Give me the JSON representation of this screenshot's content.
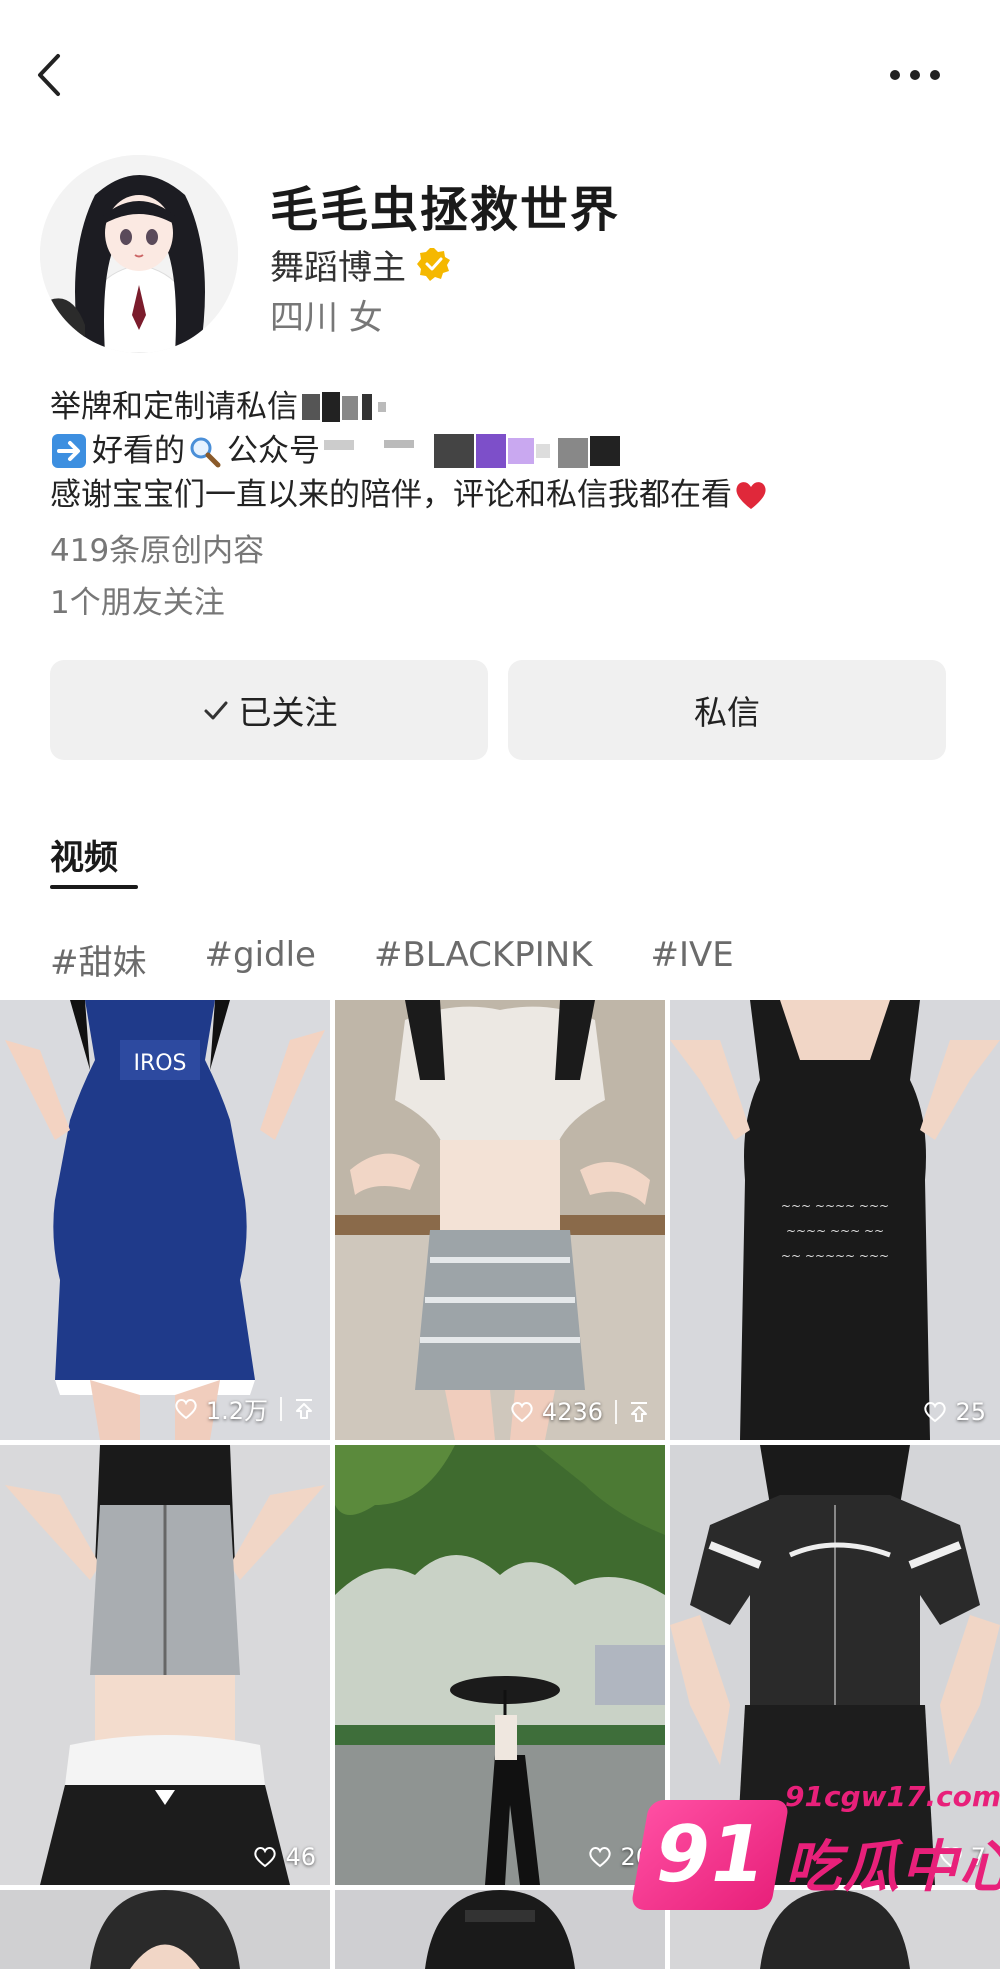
{
  "profile": {
    "name": "毛毛虫拯救世界",
    "role": "舞蹈博主",
    "location": "四川 女"
  },
  "bio": {
    "line1": "举牌和定制请私信",
    "line2_prefix": "好看的",
    "line2_text": "公众号",
    "line3": "感谢宝宝们一直以来的陪伴，评论和私信我都在看"
  },
  "stats": {
    "original_count": "419条原创内容",
    "friends_following": "1个朋友关注"
  },
  "actions": {
    "follow_label": "已关注",
    "message_label": "私信"
  },
  "tabs": [
    {
      "label": "视频"
    }
  ],
  "tags": [
    "#甜妹",
    "#gidle",
    "#BLACKPINK",
    "#IVE"
  ],
  "videos": [
    {
      "likes": "1.2万",
      "pinned": true
    },
    {
      "likes": "4236",
      "pinned": true
    },
    {
      "likes": "25",
      "pinned": false
    },
    {
      "likes": "46",
      "pinned": false
    },
    {
      "likes": "20",
      "pinned": false
    },
    {
      "likes": "7",
      "pinned": false
    }
  ],
  "watermark": {
    "badge": "91",
    "url": "91cgw17.com",
    "text": "吃瓜中心"
  },
  "colors": {
    "verified": "#f5b800",
    "watermark": "#e8207a",
    "button_bg": "#f0f0f0",
    "heart_emoji": "#e0283a"
  }
}
